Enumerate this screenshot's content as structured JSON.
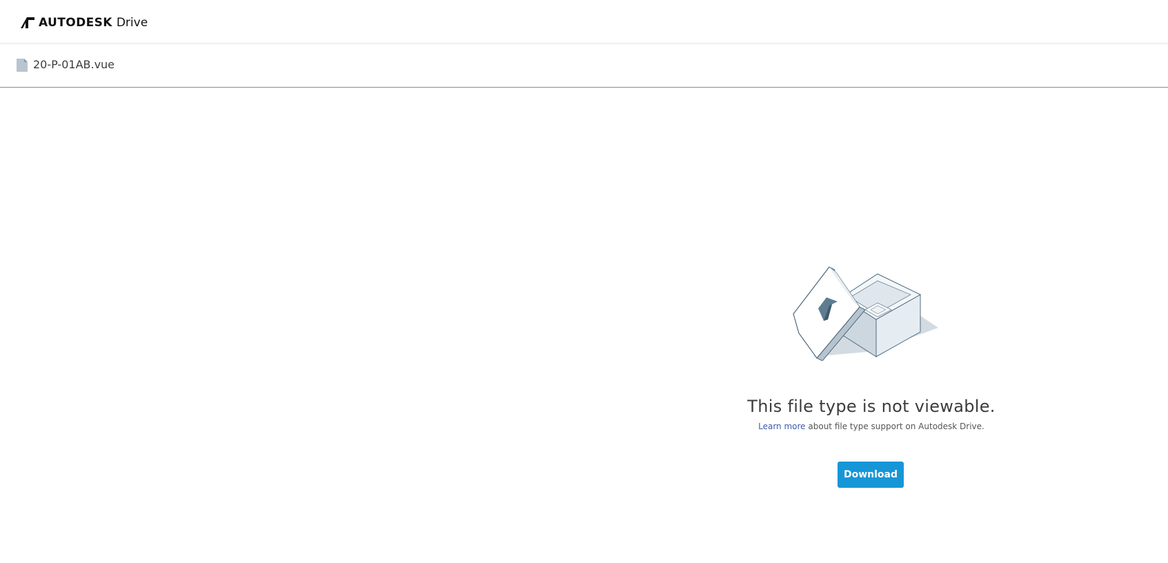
{
  "header": {
    "brand_name": "AUTODESK",
    "product_name": "Drive",
    "logo_icon": "autodesk-logo-icon"
  },
  "file": {
    "name": "20-P-01AB.vue",
    "icon": "document-icon"
  },
  "viewer": {
    "illustration": "open-box-illustration",
    "title": "This file type is not viewable.",
    "learn_more_label": "Learn more",
    "subtext_rest": " about file type support on Autodesk Drive.",
    "download_label": "Download"
  },
  "colors": {
    "accent": "#1796d7",
    "link": "#3c5ca8",
    "text": "#3c3c3c"
  }
}
